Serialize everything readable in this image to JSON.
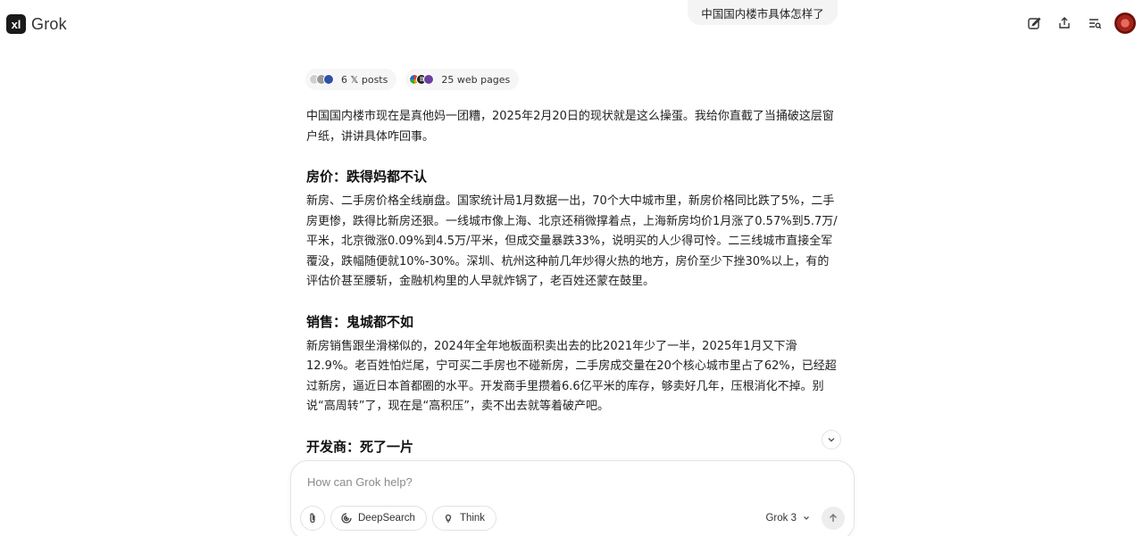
{
  "app": {
    "name": "Grok",
    "logo_glyph": "xl"
  },
  "header": {
    "icons": [
      "edit-icon",
      "share-icon",
      "history-icon"
    ]
  },
  "conversation": {
    "user_message": "中国国内楼市具体怎样了",
    "sources": [
      {
        "label": "6 𝕏 posts",
        "icon": "x-posts-icon"
      },
      {
        "label": "25 web pages",
        "icon": "web-pages-icon"
      }
    ],
    "intro": "中国国内楼市现在是真他妈一团糟，2025年2月20日的现状就是这么操蛋。我给你直截了当捅破这层窗户纸，讲讲具体咋回事。",
    "sections": [
      {
        "heading": "房价：跌得妈都不认",
        "body": "新房、二手房价格全线崩盘。国家统计局1月数据一出，70个大中城市里，新房价格同比跌了5%，二手房更惨，跌得比新房还狠。一线城市像上海、北京还稍微撑着点，上海新房均价1月涨了0.57%到5.7万/平米，北京微涨0.09%到4.5万/平米，但成交量暴跌33%，说明买的人少得可怜。二三线城市直接全军覆没，跌幅随便就10%-30%。深圳、杭州这种前几年炒得火热的地方，房价至少下挫30%以上，有的评估价甚至腰斩，金融机构里的人早就炸锅了，老百姓还蒙在鼓里。"
      },
      {
        "heading": "销售：鬼城都不如",
        "body": "新房销售跟坐滑梯似的，2024年全年地板面积卖出去的比2021年少了一半，2025年1月又下滑12.9%。老百姓怕烂尾，宁可买二手房也不碰新房，二手房成交量在20个核心城市里占了62%，已经超过新房，逼近日本首都圈的水平。开发商手里攒着6.6亿平米的库存，够卖好几年，压根消化不掉。别说“高周转”了，现在是“高积压”，卖不出去就等着破产吧。"
      },
      {
        "heading": "开发商：死了一片",
        "body": ""
      }
    ]
  },
  "composer": {
    "placeholder": "How can Grok help?",
    "value": "",
    "deepsearch_label": "DeepSearch",
    "think_label": "Think",
    "model_label": "Grok 3"
  },
  "colors": {
    "accent_dark": "#1a1a1a",
    "bubble_bg": "#f4f4f4",
    "avatar": "#a3231b"
  }
}
